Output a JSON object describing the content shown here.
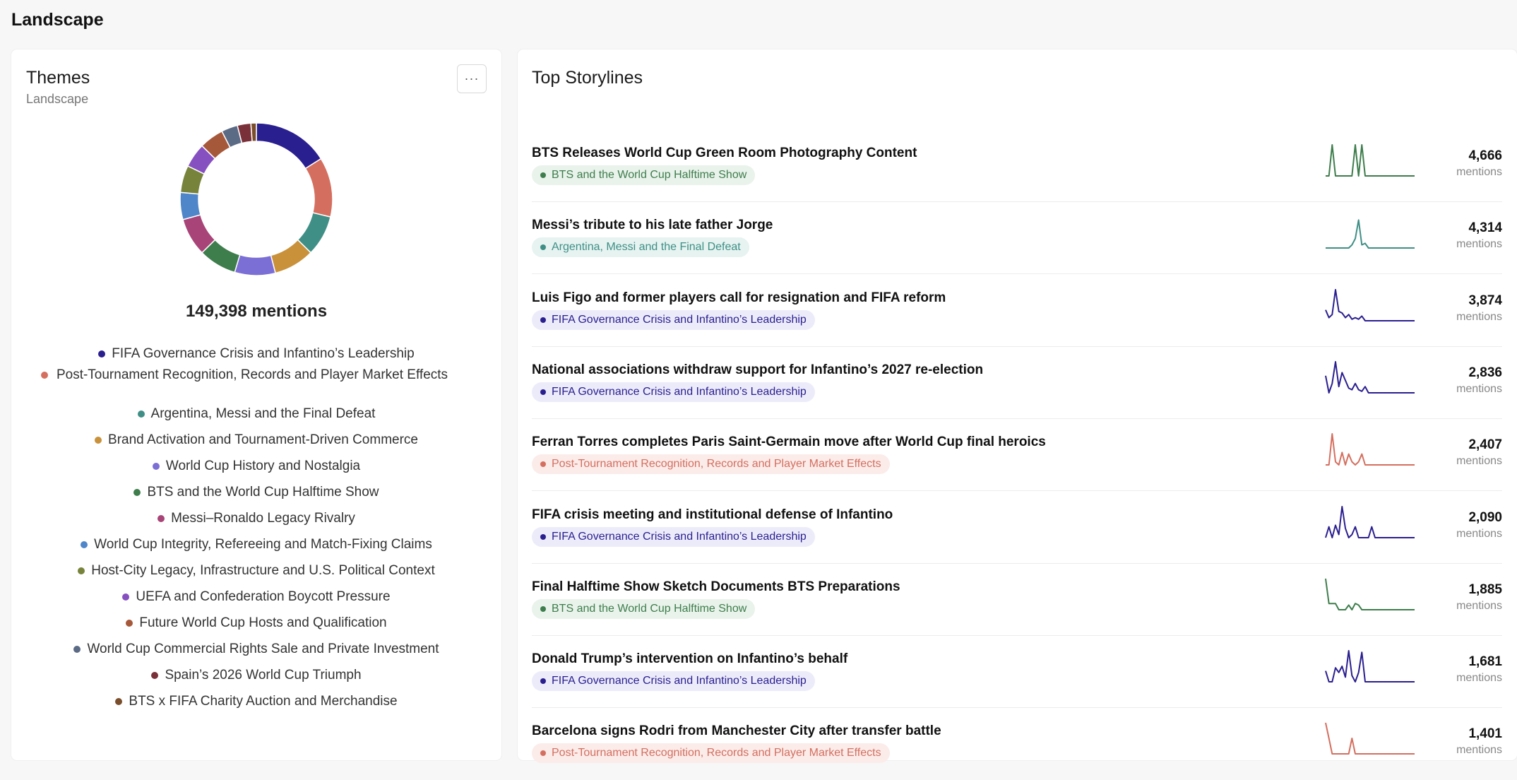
{
  "page": {
    "title": "Landscape"
  },
  "themes": {
    "title": "Themes",
    "subtitle": "Landscape",
    "menu_icon": "more-horizontal-icon",
    "total_label": "149,398 mentions",
    "legend": [
      {
        "label": "FIFA Governance Crisis and Infantino’s Leadership",
        "color": "#2a1f8f",
        "value": 14.0
      },
      {
        "label": "Post-Tournament Recognition, Records and Player Market Effects",
        "color": "#d46f5f",
        "value": 11.0
      },
      {
        "label": "Argentina, Messi and the Final Defeat",
        "color": "#3f8f86",
        "value": 7.5
      },
      {
        "label": "Brand Activation and Tournament-Driven Commerce",
        "color": "#c8913a",
        "value": 7.5
      },
      {
        "label": "World Cup History and Nostalgia",
        "color": "#7b6fd6",
        "value": 7.5
      },
      {
        "label": "BTS and the World Cup Halftime Show",
        "color": "#3e7d4c",
        "value": 7.0
      },
      {
        "label": "Messi–Ronaldo Legacy Rivalry",
        "color": "#a84477",
        "value": 7.0
      },
      {
        "label": "World Cup Integrity, Refereeing and Match-Fixing Claims",
        "color": "#4e86c9",
        "value": 5.0
      },
      {
        "label": "Host-City Legacy, Infrastructure and U.S. Political Context",
        "color": "#77823a",
        "value": 5.0
      },
      {
        "label": "UEFA and Confederation Boycott Pressure",
        "color": "#8650c0",
        "value": 4.5
      },
      {
        "label": "Future World Cup Hosts and Qualification",
        "color": "#a5583a",
        "value": 4.5
      },
      {
        "label": "World Cup Commercial Rights Sale and Private Investment",
        "color": "#5b6a85",
        "value": 3.0
      },
      {
        "label": "Spain’s 2026 World Cup Triumph",
        "color": "#7a3038",
        "value": 2.5
      },
      {
        "label": "BTS x FIFA Charity Auction and Merchandise",
        "color": "#7a4e2c",
        "value": 1.0
      }
    ]
  },
  "storylines": {
    "title": "Top Storylines",
    "mentions_label": "mentions",
    "items": [
      {
        "title": "BTS Releases World Cup Green Room Photography Content",
        "theme": "BTS and the World Cup Halftime Show",
        "color": "#3e7d4c",
        "bg": "#e9f3eb",
        "count": "4,666",
        "spark": [
          0,
          0,
          1,
          0,
          0,
          0,
          0,
          0,
          0,
          1,
          0,
          1,
          0,
          0,
          0,
          0,
          0,
          0,
          0,
          0,
          0,
          0,
          0,
          0,
          0,
          0,
          0,
          0
        ]
      },
      {
        "title": "Messi’s tribute to his late father Jorge",
        "theme": "Argentina, Messi and the Final Defeat",
        "color": "#3f8f86",
        "bg": "#e6f3f1",
        "count": "4,314",
        "spark": [
          0,
          0,
          0,
          0,
          0,
          0,
          0,
          0,
          0.1,
          0.3,
          0.9,
          0.1,
          0.15,
          0,
          0,
          0,
          0,
          0,
          0,
          0,
          0,
          0,
          0,
          0,
          0,
          0,
          0,
          0
        ]
      },
      {
        "title": "Luis Figo and former players call for resignation and FIFA reform",
        "theme": "FIFA Governance Crisis and Infantino’s Leadership",
        "color": "#2a1f8f",
        "bg": "#ecebfa",
        "count": "3,874",
        "spark": [
          0.35,
          0.1,
          0.2,
          1,
          0.3,
          0.25,
          0.1,
          0.2,
          0.05,
          0.1,
          0.05,
          0.15,
          0,
          0,
          0,
          0,
          0,
          0,
          0,
          0,
          0,
          0,
          0,
          0,
          0,
          0,
          0,
          0
        ]
      },
      {
        "title": "National associations withdraw support for Infantino’s 2027 re-election",
        "theme": "FIFA Governance Crisis and Infantino’s Leadership",
        "color": "#2a1f8f",
        "bg": "#ecebfa",
        "count": "2,836",
        "spark": [
          0.55,
          0,
          0.3,
          1,
          0.2,
          0.65,
          0.4,
          0.15,
          0.1,
          0.3,
          0.1,
          0.05,
          0.2,
          0,
          0,
          0,
          0,
          0,
          0,
          0,
          0,
          0,
          0,
          0,
          0,
          0,
          0,
          0
        ]
      },
      {
        "title": "Ferran Torres completes Paris Saint-Germain move after World Cup final heroics",
        "theme": "Post-Tournament Recognition, Records and Player Market Effects",
        "color": "#d46f5f",
        "bg": "#fbecea",
        "count": "2,407",
        "spark": [
          0,
          0,
          1,
          0.1,
          0,
          0.4,
          0,
          0.35,
          0.1,
          0,
          0.1,
          0.35,
          0,
          0,
          0,
          0,
          0,
          0,
          0,
          0,
          0,
          0,
          0,
          0,
          0,
          0,
          0,
          0
        ]
      },
      {
        "title": "FIFA crisis meeting and institutional defense of Infantino",
        "theme": "FIFA Governance Crisis and Infantino’s Leadership",
        "color": "#2a1f8f",
        "bg": "#ecebfa",
        "count": "2,090",
        "spark": [
          0,
          0.35,
          0,
          0.4,
          0.1,
          1,
          0.3,
          0,
          0.1,
          0.35,
          0,
          0,
          0,
          0,
          0.35,
          0,
          0,
          0,
          0,
          0,
          0,
          0,
          0,
          0,
          0,
          0,
          0,
          0
        ]
      },
      {
        "title": "Final Halftime Show Sketch Documents BTS Preparations",
        "theme": "BTS and the World Cup Halftime Show",
        "color": "#3e7d4c",
        "bg": "#e9f3eb",
        "count": "1,885",
        "spark": [
          1,
          0.2,
          0.2,
          0.2,
          0,
          0,
          0,
          0.15,
          0,
          0.2,
          0.15,
          0,
          0,
          0,
          0,
          0,
          0,
          0,
          0,
          0,
          0,
          0,
          0,
          0,
          0,
          0,
          0,
          0
        ]
      },
      {
        "title": "Donald Trump’s intervention on Infantino’s behalf",
        "theme": "FIFA Governance Crisis and Infantino’s Leadership",
        "color": "#2a1f8f",
        "bg": "#ecebfa",
        "count": "1,681",
        "spark": [
          0.35,
          0,
          0,
          0.45,
          0.3,
          0.5,
          0.15,
          1,
          0.2,
          0,
          0.3,
          0.95,
          0,
          0,
          0,
          0,
          0,
          0,
          0,
          0,
          0,
          0,
          0,
          0,
          0,
          0,
          0,
          0
        ]
      },
      {
        "title": "Barcelona signs Rodri from Manchester City after transfer battle",
        "theme": "Post-Tournament Recognition, Records and Player Market Effects",
        "color": "#d46f5f",
        "bg": "#fbecea",
        "count": "1,401",
        "spark": [
          1,
          0.5,
          0,
          0,
          0,
          0,
          0,
          0,
          0.5,
          0,
          0,
          0,
          0,
          0,
          0,
          0,
          0,
          0,
          0,
          0,
          0,
          0,
          0,
          0,
          0,
          0,
          0,
          0
        ]
      }
    ]
  }
}
